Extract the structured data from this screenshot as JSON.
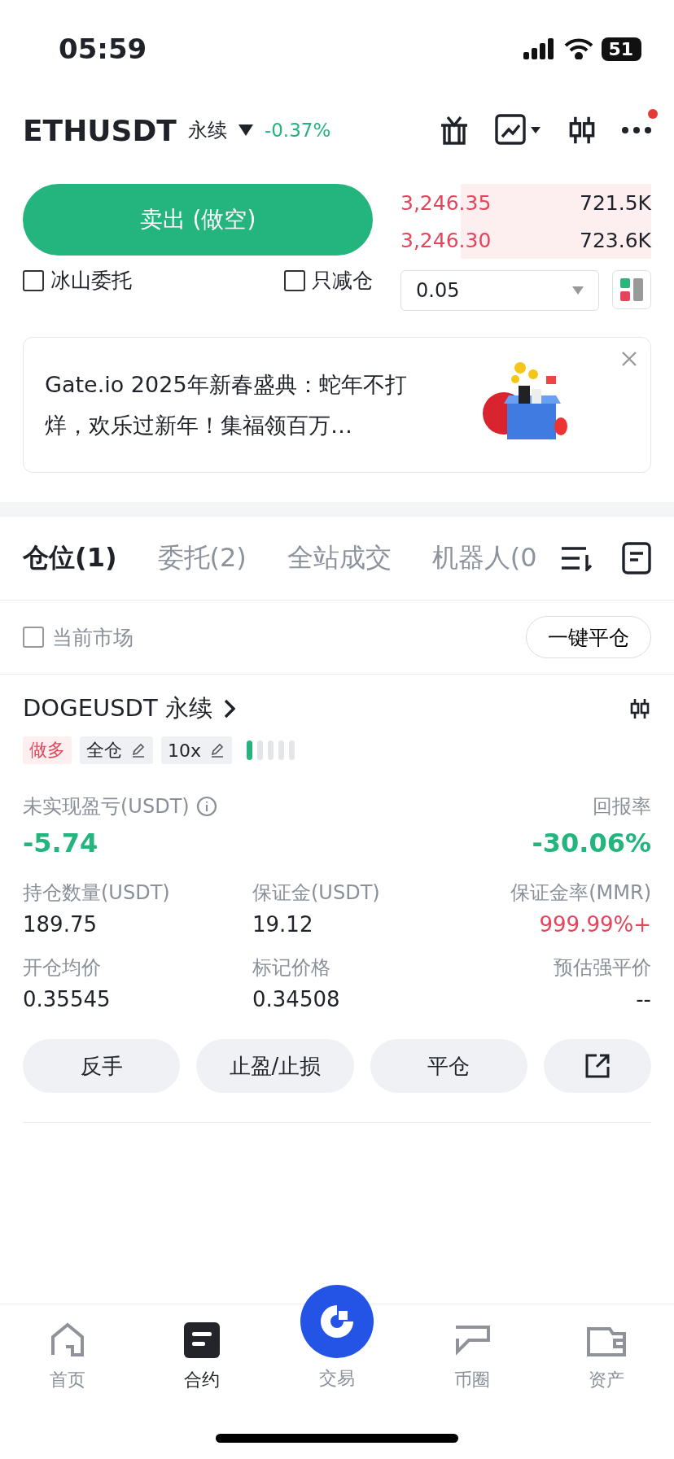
{
  "status_bar": {
    "time": "05:59",
    "battery": "51"
  },
  "header": {
    "symbol": "ETHUSDT",
    "contract": "永续",
    "change": "-0.37%",
    "has_notification": true
  },
  "order_book": {
    "rows": [
      {
        "price": "3,246.35",
        "size": "721.5K"
      },
      {
        "price": "3,246.30",
        "size": "723.6K"
      }
    ]
  },
  "sell_button": "卖出 (做空)",
  "options": [
    {
      "label": "冰山委托",
      "checked": false
    },
    {
      "label": "只减仓",
      "checked": false
    }
  ],
  "depth_select": {
    "value": "0.05"
  },
  "banner": {
    "text": "Gate.io 2025年新春盛典：蛇年不打烊，欢乐过新年！集福领百万…"
  },
  "tabs": [
    {
      "label": "仓位(1)",
      "selected": true
    },
    {
      "label": "委托(2)",
      "selected": false
    },
    {
      "label": "全站成交",
      "selected": false
    },
    {
      "label": "机器人(0",
      "selected": false
    }
  ],
  "filter": {
    "label": "当前市场",
    "checked": false,
    "close_all": "一键平仓"
  },
  "position": {
    "symbol": "DOGEUSDT 永续",
    "tags": [
      {
        "kind": "side",
        "label": "做多"
      },
      {
        "kind": "editable",
        "label": "全仓"
      },
      {
        "kind": "editable",
        "label": "10x"
      }
    ],
    "pnl_label": "未实现盈亏(USDT)",
    "pnl": "-5.74",
    "roe_label": "回报率",
    "roe": "-30.06%",
    "stats": [
      {
        "label": "持仓数量(USDT)",
        "value": "189.75",
        "warning": false
      },
      {
        "label": "保证金(USDT)",
        "value": "19.12",
        "warning": false
      },
      {
        "label": "保证金率(MMR)",
        "value": "999.99%+",
        "warning": true
      },
      {
        "label": "开仓均价",
        "value": "0.35545",
        "warning": false
      },
      {
        "label": "标记价格",
        "value": "0.34508",
        "warning": false
      },
      {
        "label": "预估强平价",
        "value": "--",
        "warning": false
      }
    ],
    "actions": [
      "反手",
      "止盈/止损",
      "平仓"
    ]
  },
  "nav": [
    {
      "label": "首页",
      "selected": false,
      "kind": "home"
    },
    {
      "label": "合约",
      "selected": true,
      "kind": "futures"
    },
    {
      "label": "交易",
      "selected": false,
      "kind": "trade"
    },
    {
      "label": "币圈",
      "selected": false,
      "kind": "chat"
    },
    {
      "label": "资产",
      "selected": false,
      "kind": "wallet"
    }
  ]
}
